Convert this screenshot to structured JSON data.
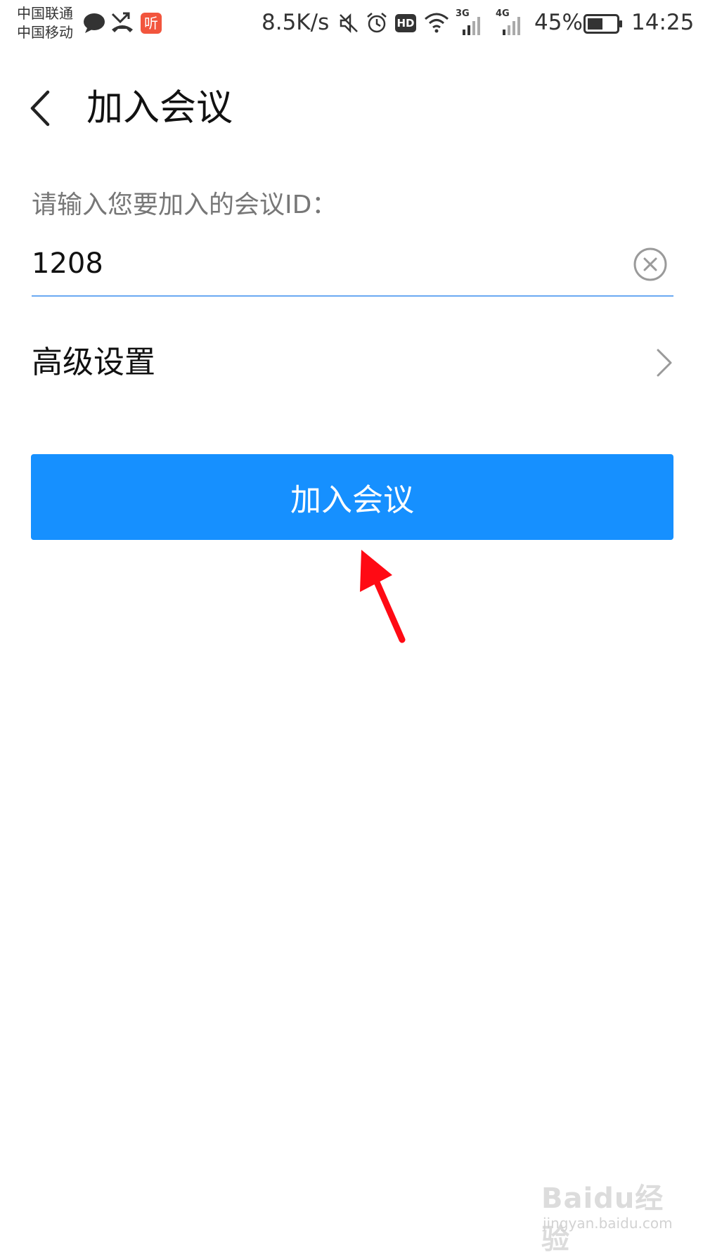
{
  "status_bar": {
    "carrier_1": "中国联通",
    "carrier_2": "中国移动",
    "network_speed": "8.5K/s",
    "hd_badge": "HD",
    "signal_1_label": "3G",
    "signal_2_label": "4G",
    "battery_percent": "45%",
    "time": "14:25",
    "notification_app_badge": "听",
    "icons": [
      "chat-bubble-icon",
      "missed-call-icon",
      "listen-app-icon",
      "mute-icon",
      "alarm-icon",
      "hd-icon",
      "wifi-icon",
      "signal-3g-icon",
      "signal-4g-icon",
      "battery-icon"
    ]
  },
  "header": {
    "title": "加入会议",
    "back_icon": "chevron-left-icon"
  },
  "form": {
    "meeting_id_label": "请输入您要加入的会议ID：",
    "meeting_id_value": "1208",
    "clear_icon": "clear-circle-icon"
  },
  "advanced": {
    "label": "高级设置",
    "icon": "chevron-right-icon"
  },
  "join_button": {
    "label": "加入会议"
  },
  "watermark": {
    "brand": "Baidu经验",
    "url": "jingyan.baidu.com"
  },
  "colors": {
    "primary": "#1690ff",
    "input_underline": "#6aa9f2",
    "annotation_arrow": "#ff0a14",
    "listen_badge": "#f2553d"
  }
}
